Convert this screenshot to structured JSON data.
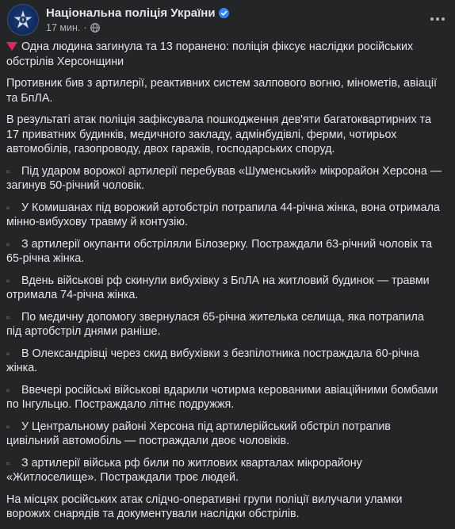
{
  "header": {
    "page_name": "Національна поліція України",
    "time": "17 мин.",
    "separator": "·"
  },
  "post": {
    "headline": "Одна людина загинула та 13 поранено: поліція фіксує наслідки російських обстрілів Херсонщини",
    "p1": "Противник бив з артилерії, реактивних систем залпового вогню, мінометів, авіації та БпЛА.",
    "p2": "В результаті атак поліція зафіксувала пошкодження дев'яти багатоквартирних та 17 приватних будинків, медичного закладу, адмінбудівлі, ферми, чотирьох автомобілів, газопроводу, двох гаражів, господарських споруд.",
    "items": [
      "Під ударом ворожої артилерії перебував «Шуменський» мікрорайон Херсона — загинув 50-річний чоловік.",
      "У Комишанах під ворожий артобстріл потрапила 44-річна жінка, вона отримала мінно-вибухову травму й контузію.",
      "З артилерії окупанти обстріляли Білозерку. Постраждали 63-річний чоловік та 65-річна жінка.",
      "Вдень військові рф скинули вибухівку з БпЛА на житловий будинок — травми отримала 74-річна жінка.",
      "По медичну допомогу звернулася 65-річна жителька селища, яка потрапила під артобстріл днями раніше.",
      "В Олександрівці через скид вибухівки з безпілотника постраждала 60-річна жінка.",
      "Ввечері російські військові вдарили чотирма керованими авіаційними бомбами по Інгульцю. Постраждало літнє подружжя.",
      "У Центральному районі Херсона під артилерійський обстріл потрапив цивільний автомобіль — постраждали двоє чоловіків.",
      "З артилерії війська рф били по житлових кварталах мікрорайону «Житлоселище». Постраждали троє людей."
    ],
    "bullet": "▫",
    "closing": "На місцях російських атак слідчо-оперативні групи поліції вилучали уламки ворожих снарядів та документували наслідки обстрілів."
  },
  "icons": {
    "avatar": "police-emblem-icon",
    "verified": "verified-badge-icon",
    "audience": "globe-icon",
    "more": "more-options-icon",
    "headline": "red-triangle-icon"
  },
  "colors": {
    "background": "#242526",
    "text": "#e4e6eb",
    "secondary": "#b0b3b8",
    "verified": "#2d88ff",
    "alert": "#e0245e"
  }
}
